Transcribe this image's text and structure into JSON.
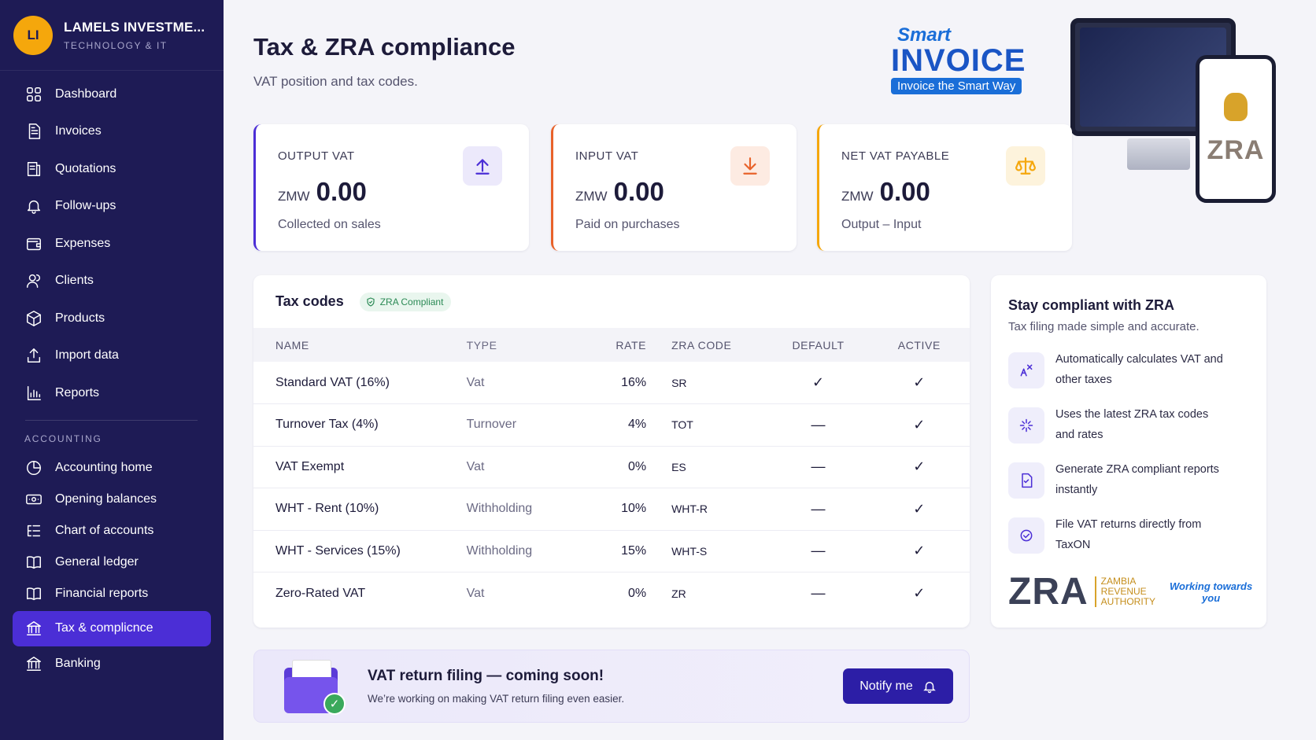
{
  "org": {
    "initials": "LI",
    "name": "LAMELS INVESTME...",
    "sub": "TECHNOLOGY & IT"
  },
  "nav": {
    "main": [
      {
        "label": "Dashboard",
        "icon": "dashboard-icon"
      },
      {
        "label": "Invoices",
        "icon": "invoice-icon"
      },
      {
        "label": "Quotations",
        "icon": "quotation-icon"
      },
      {
        "label": "Follow-ups",
        "icon": "bell-icon"
      },
      {
        "label": "Expenses",
        "icon": "wallet-icon"
      },
      {
        "label": "Clients",
        "icon": "users-icon"
      },
      {
        "label": "Products",
        "icon": "box-icon"
      },
      {
        "label": "Import data",
        "icon": "upload-icon"
      },
      {
        "label": "Reports",
        "icon": "bar-chart-icon"
      }
    ],
    "accounting_label": "ACCOUNTING",
    "accounting": [
      {
        "label": "Accounting home",
        "icon": "pie-icon"
      },
      {
        "label": "Opening balances",
        "icon": "money-icon"
      },
      {
        "label": "Chart of accounts",
        "icon": "list-tree-icon"
      },
      {
        "label": "General ledger",
        "icon": "book-icon"
      },
      {
        "label": "Financial reports",
        "icon": "book-icon"
      },
      {
        "label": "Tax & complicnce",
        "icon": "bank-icon",
        "active": true
      },
      {
        "label": "Banking",
        "icon": "bank-icon"
      }
    ]
  },
  "page": {
    "title": "Tax & ZRA compliance",
    "subtitle": "VAT position and tax codes."
  },
  "promo": {
    "smart": "Smart",
    "invoice": "INVOICE",
    "tagline": "Invoice the Smart Way",
    "phone_brand": "ZRA"
  },
  "kpis": [
    {
      "label": "OUTPUT VAT",
      "currency": "ZMW",
      "value": "0.00",
      "note": "Collected on sales",
      "color": "#4b2ed6",
      "icon_bg": "#ece9fb",
      "icon": "upload-arrow-icon"
    },
    {
      "label": "INPUT VAT",
      "currency": "ZMW",
      "value": "0.00",
      "note": "Paid on purchases",
      "color": "#e8622a",
      "icon_bg": "#fdebe2",
      "icon": "download-arrow-icon"
    },
    {
      "label": "NET VAT PAYABLE",
      "currency": "ZMW",
      "value": "0.00",
      "note": "Output – Input",
      "color": "#f5a70c",
      "icon_bg": "#fdf3dc",
      "icon": "scale-icon"
    }
  ],
  "tax_codes": {
    "title": "Tax codes",
    "badge": "ZRA Compliant",
    "columns": [
      "NAME",
      "TYPE",
      "RATE",
      "ZRA CODE",
      "DEFAULT",
      "ACTIVE"
    ],
    "rows": [
      {
        "name": "Standard VAT (16%)",
        "type": "Vat",
        "rate": "16%",
        "zra": "SR",
        "default": "✓",
        "active": "✓"
      },
      {
        "name": "Turnover Tax (4%)",
        "type": "Turnover",
        "rate": "4%",
        "zra": "TOT",
        "default": "—",
        "active": "✓"
      },
      {
        "name": "VAT Exempt",
        "type": "Vat",
        "rate": "0%",
        "zra": "ES",
        "default": "—",
        "active": "✓"
      },
      {
        "name": "WHT - Rent (10%)",
        "type": "Withholding",
        "rate": "10%",
        "zra": "WHT-R",
        "default": "—",
        "active": "✓"
      },
      {
        "name": "WHT - Services (15%)",
        "type": "Withholding",
        "rate": "15%",
        "zra": "WHT-S",
        "default": "—",
        "active": "✓"
      },
      {
        "name": "Zero-Rated VAT",
        "type": "Vat",
        "rate": "0%",
        "zra": "ZR",
        "default": "—",
        "active": "✓"
      }
    ]
  },
  "compliance": {
    "title": "Stay compliant with ZRA",
    "subtitle": "Tax filing made simple and accurate.",
    "features": [
      {
        "text": "Automatically calculates VAT and other taxes",
        "icon": "calculate-icon"
      },
      {
        "text": "Uses the latest ZRA tax codes and rates",
        "icon": "sparkle-icon"
      },
      {
        "text": "Generate ZRA compliant reports instantly",
        "icon": "report-icon"
      },
      {
        "text": "File VAT returns directly from TaxON",
        "icon": "file-return-icon"
      }
    ],
    "zra_logo": "ZRA",
    "zra_line1": "ZAMBIA",
    "zra_line2": "REVENUE",
    "zra_line3": "AUTHORITY",
    "slogan1": "Working towards",
    "slogan2": "you"
  },
  "banner": {
    "title": "VAT return filing — coming soon!",
    "subtitle": "We’re working on making VAT return filing even easier.",
    "button": "Notify me"
  }
}
